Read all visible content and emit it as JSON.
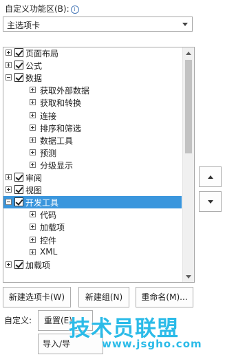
{
  "header": {
    "title": "自定义功能区(B):",
    "info_icon": "ⓘ"
  },
  "dropdown": {
    "selected": "主选项卡"
  },
  "tree": {
    "items": [
      {
        "label": "页面布局",
        "level": 0,
        "expander": "plus",
        "checked": true,
        "selected": false
      },
      {
        "label": "公式",
        "level": 0,
        "expander": "plus",
        "checked": true,
        "selected": false
      },
      {
        "label": "数据",
        "level": 0,
        "expander": "minus",
        "checked": true,
        "selected": false
      },
      {
        "label": "获取外部数据",
        "level": 1,
        "expander": "plus",
        "checked": false,
        "selected": false
      },
      {
        "label": "获取和转换",
        "level": 1,
        "expander": "plus",
        "checked": false,
        "selected": false
      },
      {
        "label": "连接",
        "level": 1,
        "expander": "plus",
        "checked": false,
        "selected": false
      },
      {
        "label": "排序和筛选",
        "level": 1,
        "expander": "plus",
        "checked": false,
        "selected": false
      },
      {
        "label": "数据工具",
        "level": 1,
        "expander": "plus",
        "checked": false,
        "selected": false
      },
      {
        "label": "预测",
        "level": 1,
        "expander": "plus",
        "checked": false,
        "selected": false
      },
      {
        "label": "分级显示",
        "level": 1,
        "expander": "plus",
        "checked": false,
        "selected": false
      },
      {
        "label": "审阅",
        "level": 0,
        "expander": "plus",
        "checked": true,
        "selected": false
      },
      {
        "label": "视图",
        "level": 0,
        "expander": "plus",
        "checked": true,
        "selected": false
      },
      {
        "label": "开发工具",
        "level": 0,
        "expander": "minus",
        "checked": true,
        "selected": true
      },
      {
        "label": "代码",
        "level": 1,
        "expander": "plus",
        "checked": false,
        "selected": false
      },
      {
        "label": "加载项",
        "level": 1,
        "expander": "plus",
        "checked": false,
        "selected": false
      },
      {
        "label": "控件",
        "level": 1,
        "expander": "plus",
        "checked": false,
        "selected": false
      },
      {
        "label": "XML",
        "level": 1,
        "expander": "plus",
        "checked": false,
        "selected": false
      },
      {
        "label": "加载项",
        "level": 0,
        "expander": "plus",
        "checked": true,
        "selected": false
      }
    ]
  },
  "buttons": {
    "new_tab": "新建选项卡(W)",
    "new_group": "新建组(N)",
    "rename": "重命名(M)...",
    "reset": "重置(E)",
    "import_export": "导入/导"
  },
  "customize_label": "自定义:",
  "watermark": {
    "main": "技术员联盟",
    "url": "www.jsgho.com"
  },
  "colors": {
    "selection": "#3a96dd",
    "watermark": "#2bbbe8"
  }
}
